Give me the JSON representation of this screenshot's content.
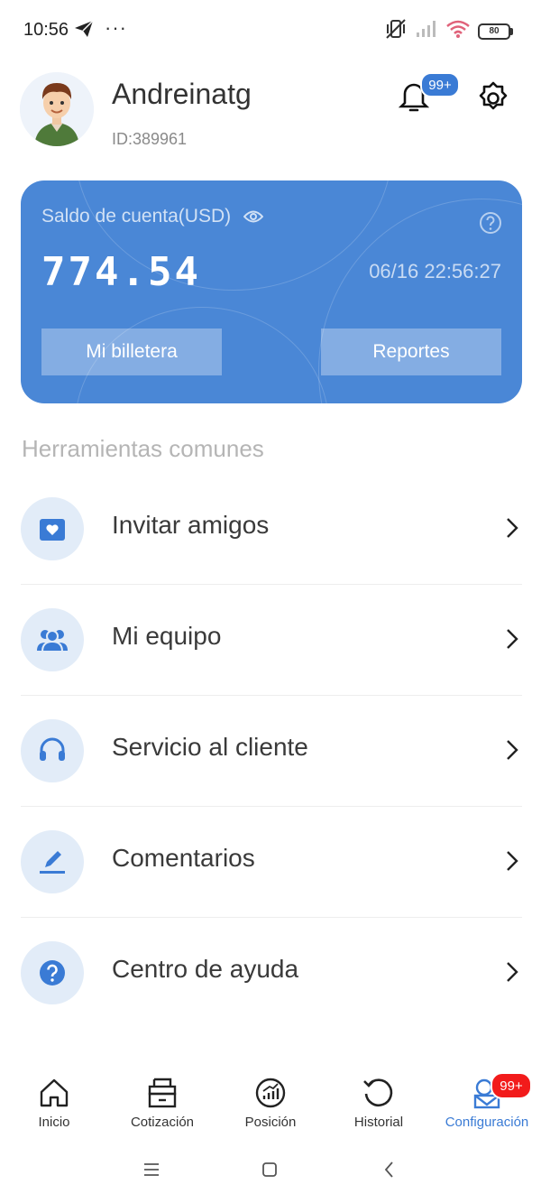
{
  "status_bar": {
    "time": "10:56",
    "dots": "···",
    "battery": "80"
  },
  "profile": {
    "username": "Andreinatg",
    "user_id": "ID:389961",
    "notification_badge": "99+"
  },
  "account_card": {
    "label": "Saldo de cuenta(USD)",
    "amount": "774.54",
    "timestamp": "06/16 22:56:27",
    "wallet_button": "Mi billetera",
    "reports_button": "Reportes"
  },
  "tools": {
    "title": "Herramientas comunes",
    "items": [
      {
        "label": "Invitar amigos",
        "icon": "invite-icon"
      },
      {
        "label": "Mi equipo",
        "icon": "team-icon"
      },
      {
        "label": "Servicio al cliente",
        "icon": "headset-icon"
      },
      {
        "label": "Comentarios",
        "icon": "pen-icon"
      },
      {
        "label": "Centro de ayuda",
        "icon": "help-icon"
      }
    ]
  },
  "bottom_nav": {
    "items": [
      {
        "label": "Inicio",
        "icon": "home-icon"
      },
      {
        "label": "Cotización",
        "icon": "quote-icon"
      },
      {
        "label": "Posición",
        "icon": "position-icon"
      },
      {
        "label": "Historial",
        "icon": "history-icon"
      },
      {
        "label": "Configuración",
        "icon": "profile-icon",
        "active": true,
        "badge": "99+"
      }
    ]
  },
  "colors": {
    "accent": "#3a7bd5",
    "card": "#4a87d6",
    "badge_red": "#f21b1b",
    "icon_bg": "#e2ecf8"
  }
}
